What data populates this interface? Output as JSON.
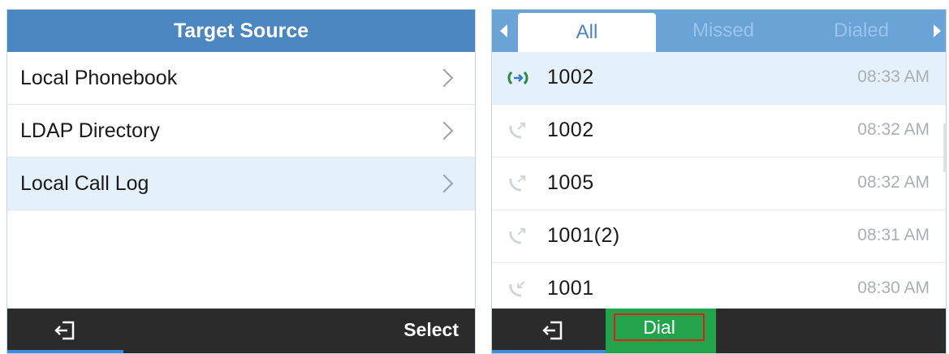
{
  "left_screen": {
    "title": "Target Source",
    "items": [
      {
        "label": "Local Phonebook"
      },
      {
        "label": "LDAP Directory"
      },
      {
        "label": "Local Call Log"
      }
    ],
    "softkeys": {
      "back_icon": "exit-icon",
      "select_label": "Select"
    }
  },
  "right_screen": {
    "tabs": [
      {
        "label": "All"
      },
      {
        "label": "Missed"
      },
      {
        "label": "Dialed"
      }
    ],
    "calls": [
      {
        "number": "1002",
        "time": "08:33 AM",
        "icon": "call-connected-icon"
      },
      {
        "number": "1002",
        "time": "08:32 AM",
        "icon": "outgoing-call-icon"
      },
      {
        "number": "1005",
        "time": "08:32 AM",
        "icon": "outgoing-call-icon"
      },
      {
        "number": "1001(2)",
        "time": "08:31 AM",
        "icon": "outgoing-call-icon"
      },
      {
        "number": "1001",
        "time": "08:30 AM",
        "icon": "incoming-call-icon"
      }
    ],
    "softkeys": {
      "back_icon": "exit-icon",
      "dial_label": "Dial"
    }
  },
  "colors": {
    "title_bar": "#4a86bf",
    "tab_bar": "#6aa3d6",
    "selection": "#e4f0fa",
    "softkey_bar": "#2b2b2b",
    "dial_key": "#22a54a",
    "dial_highlight": "#e21b1b",
    "underline": "#3d8ad6"
  }
}
